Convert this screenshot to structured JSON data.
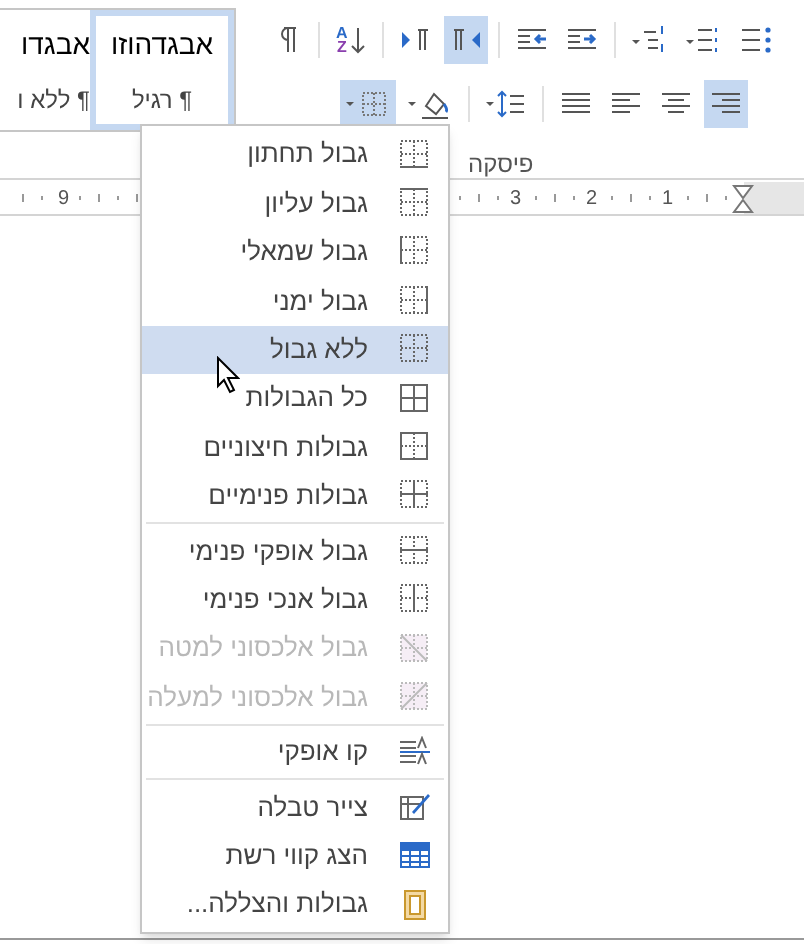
{
  "styles": [
    {
      "sample": "אבגדהוזו",
      "name": "¶ רגיל",
      "selected": true
    },
    {
      "sample": "אבגדו",
      "name": "¶ ללא ו",
      "selected": false
    }
  ],
  "top_buttons": [
    {
      "selected": false
    },
    {
      "selected": false,
      "letters": [
        "A",
        "Z"
      ]
    },
    {
      "selected": false
    },
    {
      "selected": true
    },
    {
      "selected": false
    },
    {
      "selected": false
    },
    {
      "selected": false
    },
    {
      "selected": false
    },
    {
      "selected": false
    }
  ],
  "bottom_buttons": [
    {
      "selected": true
    },
    {
      "selected": false
    },
    {
      "selected": false
    },
    {
      "selected": false
    },
    {
      "selected": false
    },
    {
      "selected": false
    },
    {
      "selected": true
    }
  ],
  "group_label": "פיסקה",
  "ruler": {
    "left_labels": [
      "9"
    ],
    "right_labels": [
      "1",
      "2",
      "3"
    ]
  },
  "menu": [
    {
      "label": "גבול תחתון",
      "selected": false,
      "disabled": false,
      "separator_before": false
    },
    {
      "label": "גבול עליון",
      "selected": false,
      "disabled": false,
      "separator_before": false
    },
    {
      "label": "גבול שמאלי",
      "selected": false,
      "disabled": false,
      "separator_before": false
    },
    {
      "label": "גבול ימני",
      "selected": false,
      "disabled": false,
      "separator_before": false
    },
    {
      "label": "ללא גבול",
      "selected": true,
      "disabled": false,
      "separator_before": false
    },
    {
      "label": "כל הגבולות",
      "selected": false,
      "disabled": false,
      "separator_before": false
    },
    {
      "label": "גבולות חיצוניים",
      "selected": false,
      "disabled": false,
      "separator_before": false
    },
    {
      "label": "גבולות פנימיים",
      "selected": false,
      "disabled": false,
      "separator_before": false
    },
    {
      "label": "גבול אופקי פנימי",
      "selected": false,
      "disabled": false,
      "separator_before": true
    },
    {
      "label": "גבול אנכי פנימי",
      "selected": false,
      "disabled": false,
      "separator_before": false
    },
    {
      "label": "גבול אלכסוני למטה",
      "selected": false,
      "disabled": true,
      "separator_before": false
    },
    {
      "label": "גבול אלכסוני למעלה",
      "selected": false,
      "disabled": true,
      "separator_before": false
    },
    {
      "label": "קו אופקי",
      "selected": false,
      "disabled": false,
      "separator_before": true
    },
    {
      "label": "צייר טבלה",
      "selected": false,
      "disabled": false,
      "separator_before": true
    },
    {
      "label": "הצג קווי רשת",
      "selected": false,
      "disabled": false,
      "separator_before": false
    },
    {
      "label": "גבולות והצללה...",
      "selected": false,
      "disabled": false,
      "separator_before": false
    }
  ]
}
